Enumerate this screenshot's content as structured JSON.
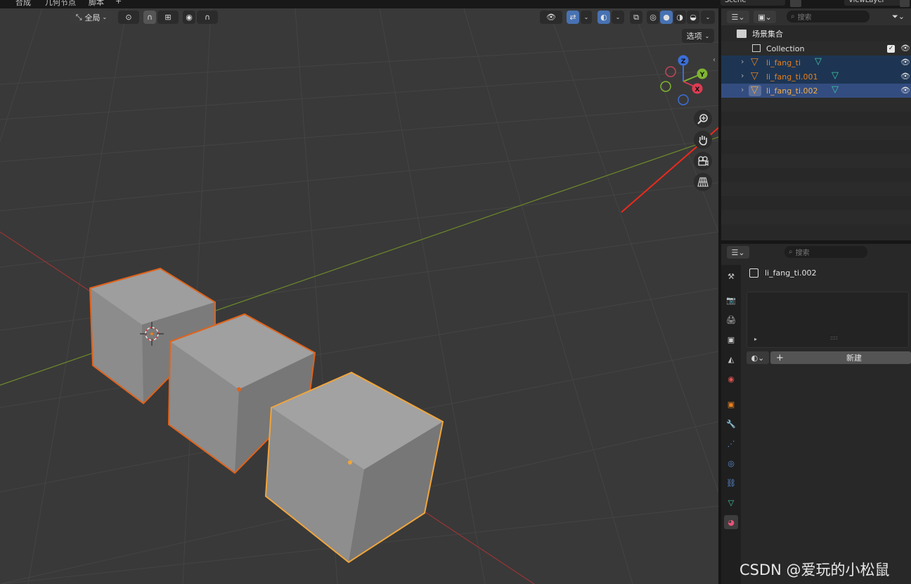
{
  "topbar": {
    "menus": [
      "合成",
      "几何节点",
      "脚本",
      "+"
    ],
    "scene_name": "Scene",
    "view_layer": "ViewLayer"
  },
  "viewport": {
    "transform_orientation": "全局",
    "options_label": "选项",
    "gizmo_axes": [
      "Z",
      "Y",
      "X"
    ],
    "nav_buttons": [
      "zoom-icon",
      "hand-pan-icon",
      "camera-icon",
      "grid-ortho-icon"
    ]
  },
  "outliner": {
    "search_placeholder": "搜索",
    "scene_collection": "场景集合",
    "collection": "Collection",
    "objects": [
      {
        "name": "li_fang_ti",
        "selected": false
      },
      {
        "name": "li_fang_ti.001",
        "selected": false
      },
      {
        "name": "li_fang_ti.002",
        "selected": true
      }
    ]
  },
  "properties": {
    "search_placeholder": "搜索",
    "object_name": "li_fang_ti.002",
    "new_button": "新建",
    "tabs": [
      "tool-icon",
      "render-icon",
      "output-icon",
      "view-layer-icon",
      "scene-icon",
      "world-icon",
      "object-icon",
      "modifier-icon",
      "particles-icon",
      "physics-icon",
      "constraints-icon",
      "data-icon",
      "material-icon"
    ]
  },
  "colors": {
    "accent_orange": "#e8801c",
    "selection_blue": "#334d80",
    "row_highlight": "#1d3553",
    "mesh_green": "#42c7a6",
    "annotation_red": "#ee2a1c"
  },
  "watermark": "CSDN @爱玩的小松鼠"
}
